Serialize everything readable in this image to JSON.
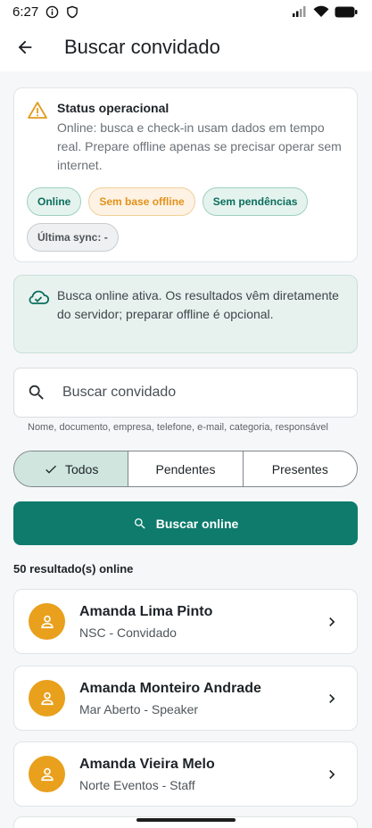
{
  "status_bar": {
    "time": "6:27"
  },
  "app_bar": {
    "title": "Buscar convidado"
  },
  "status_card": {
    "title": "Status operacional",
    "text": "Online: busca e check-in usam dados em tempo real. Prepare offline apenas se precisar operar sem internet.",
    "chips": {
      "online": "Online",
      "offline_base": "Sem base offline",
      "pending": "Sem pendências",
      "last_sync": "Última sync: -"
    }
  },
  "online_card": {
    "text": "Busca online ativa. Os resultados vêm diretamente do servidor; preparar offline é opcional."
  },
  "search": {
    "placeholder": "Buscar convidado",
    "value": "",
    "helper": "Nome, documento, empresa, telefone, e-mail, categoria, responsável"
  },
  "filters": {
    "all": "Todos",
    "pending": "Pendentes",
    "present": "Presentes",
    "selected": "Todos"
  },
  "search_button": "Buscar online",
  "results": {
    "count_label": "50 resultado(s) online",
    "items": [
      {
        "name": "Amanda Lima Pinto",
        "subtitle": "NSC - Convidado"
      },
      {
        "name": "Amanda Monteiro Andrade",
        "subtitle": "Mar Aberto - Speaker"
      },
      {
        "name": "Amanda Vieira Melo",
        "subtitle": "Norte Eventos - Staff"
      }
    ]
  },
  "colors": {
    "primary": "#0e7b6d",
    "avatar": "#e9a01c",
    "warning": "#e39a1b",
    "online_bg": "#e7f2ef"
  },
  "icons": [
    "wifi-icon",
    "signal-icon",
    "battery-icon",
    "info-icon",
    "vpn-icon",
    "back-arrow-icon",
    "warning-icon",
    "cloud-check-icon",
    "search-icon",
    "check-icon",
    "person-icon",
    "chevron-right-icon"
  ]
}
